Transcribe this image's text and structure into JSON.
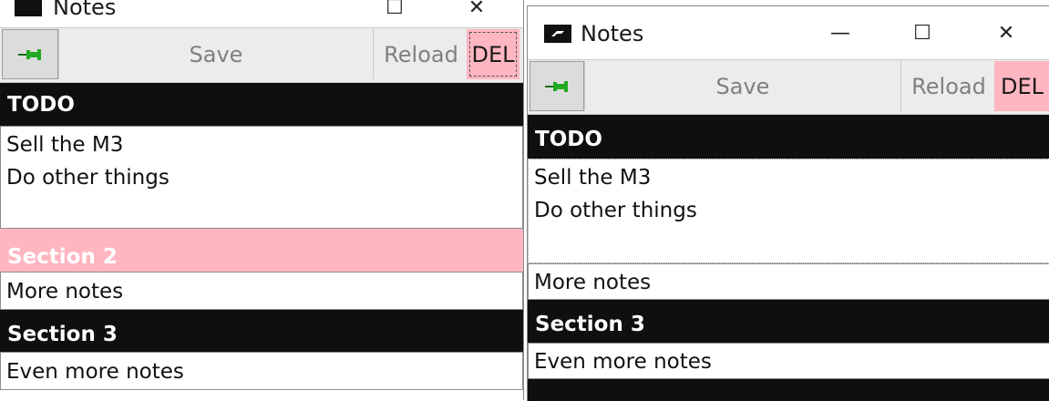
{
  "window": {
    "title": "Notes",
    "minimize_glyph": "—",
    "maximize_glyph": "☐",
    "close_glyph": "✕",
    "app_icon": "app-logo-icon"
  },
  "toolbar": {
    "pin_icon": "pin-icon",
    "pin_color": "#22aa22",
    "save_label": "Save",
    "reload_label": "Reload",
    "delete_label": "DEL",
    "delete_color": "#ffb6c1"
  },
  "left": {
    "sections": [
      {
        "title": "TODO",
        "body": "Sell the M3\nDo other things",
        "header_color": "#0f0f0f"
      },
      {
        "title": "Section 2",
        "body": "More notes",
        "header_color": "#ffb6c1"
      },
      {
        "title": "Section 3",
        "body": "Even more notes",
        "header_color": "#0f0f0f"
      }
    ]
  },
  "right": {
    "sections": [
      {
        "title": "TODO",
        "body": "Sell the M3\nDo other things"
      },
      {
        "title": "",
        "body": "More notes"
      },
      {
        "title": "Section 3",
        "body": "Even more notes"
      }
    ]
  }
}
